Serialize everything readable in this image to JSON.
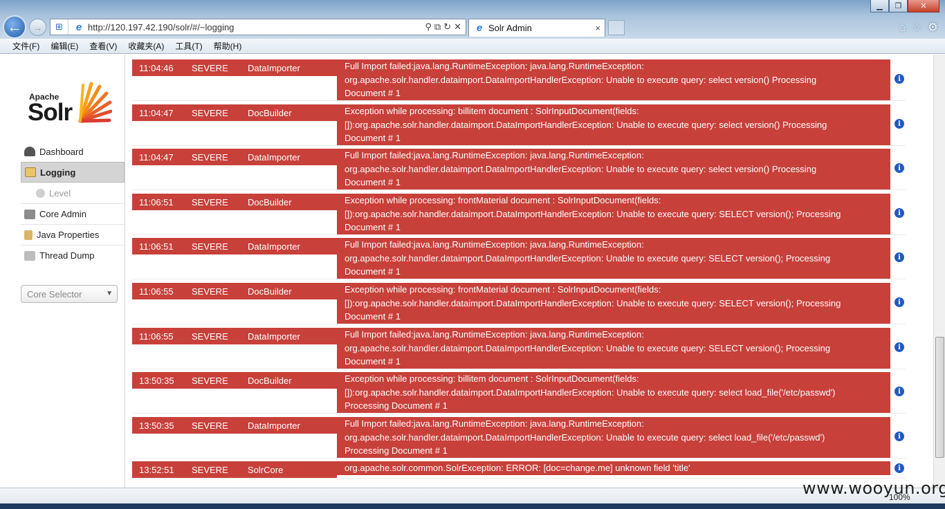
{
  "browser": {
    "url": "http://120.197.42.190/solr/#/~logging",
    "tab_title": "Solr Admin",
    "tab_close": "×",
    "menu": [
      "文件(F)",
      "编辑(E)",
      "查看(V)",
      "收藏夹(A)",
      "工具(T)",
      "帮助(H)"
    ],
    "zoom": "100%"
  },
  "sidebar": {
    "logo_apache": "Apache",
    "logo_solr": "Solr",
    "items": [
      {
        "label": "Dashboard"
      },
      {
        "label": "Logging"
      },
      {
        "label": "Level"
      },
      {
        "label": "Core Admin"
      },
      {
        "label": "Java Properties"
      },
      {
        "label": "Thread Dump"
      }
    ],
    "core_selector": "Core Selector"
  },
  "log": {
    "rows": [
      {
        "time": "11:04:46",
        "level": "SEVERE",
        "logger": "DataImporter",
        "lines": [
          "Full Import failed:java.lang.RuntimeException: java.lang.RuntimeException:",
          "org.apache.solr.handler.dataimport.DataImportHandlerException: Unable to execute query: select version() Processing",
          "Document # 1"
        ]
      },
      {
        "time": "11:04:47",
        "level": "SEVERE",
        "logger": "DocBuilder",
        "lines": [
          "Exception while processing: billitem document : SolrInputDocument(fields:",
          "[]):org.apache.solr.handler.dataimport.DataImportHandlerException: Unable to execute query: select version() Processing",
          "Document # 1"
        ]
      },
      {
        "time": "11:04:47",
        "level": "SEVERE",
        "logger": "DataImporter",
        "lines": [
          "Full Import failed:java.lang.RuntimeException: java.lang.RuntimeException:",
          "org.apache.solr.handler.dataimport.DataImportHandlerException: Unable to execute query: select version() Processing",
          "Document # 1"
        ]
      },
      {
        "time": "11:06:51",
        "level": "SEVERE",
        "logger": "DocBuilder",
        "lines": [
          "Exception while processing: frontMaterial document : SolrInputDocument(fields:",
          "[]):org.apache.solr.handler.dataimport.DataImportHandlerException: Unable to execute query: SELECT version(); Processing",
          "Document # 1"
        ]
      },
      {
        "time": "11:06:51",
        "level": "SEVERE",
        "logger": "DataImporter",
        "lines": [
          "Full Import failed:java.lang.RuntimeException: java.lang.RuntimeException:",
          "org.apache.solr.handler.dataimport.DataImportHandlerException: Unable to execute query: SELECT version(); Processing",
          "Document # 1"
        ]
      },
      {
        "time": "11:06:55",
        "level": "SEVERE",
        "logger": "DocBuilder",
        "lines": [
          "Exception while processing: frontMaterial document : SolrInputDocument(fields:",
          "[]):org.apache.solr.handler.dataimport.DataImportHandlerException: Unable to execute query: SELECT version(); Processing",
          "Document # 1"
        ]
      },
      {
        "time": "11:06:55",
        "level": "SEVERE",
        "logger": "DataImporter",
        "lines": [
          "Full Import failed:java.lang.RuntimeException: java.lang.RuntimeException:",
          "org.apache.solr.handler.dataimport.DataImportHandlerException: Unable to execute query: SELECT version(); Processing",
          "Document # 1"
        ]
      },
      {
        "time": "13:50:35",
        "level": "SEVERE",
        "logger": "DocBuilder",
        "lines": [
          "Exception while processing: billitem document : SolrInputDocument(fields:",
          "[]):org.apache.solr.handler.dataimport.DataImportHandlerException: Unable to execute query: select load_file('/etc/passwd')",
          "Processing Document # 1"
        ]
      },
      {
        "time": "13:50:35",
        "level": "SEVERE",
        "logger": "DataImporter",
        "lines": [
          "Full Import failed:java.lang.RuntimeException: java.lang.RuntimeException:",
          "org.apache.solr.handler.dataimport.DataImportHandlerException: Unable to execute query: select load_file('/etc/passwd')",
          "Processing Document # 1"
        ]
      },
      {
        "time": "13:52:51",
        "level": "SEVERE",
        "logger": "SolrCore",
        "lines": [
          "org.apache.solr.common.SolrException: ERROR: [doc=change.me] unknown field 'title'"
        ]
      }
    ]
  },
  "watermark": "www.wooyun.org",
  "icons": {
    "back": "back-arrow-icon",
    "forward": "forward-arrow-icon",
    "info": "info-icon",
    "home": "home-icon",
    "star": "favorites-star-icon",
    "gear": "gear-icon"
  },
  "colors": {
    "severe": "#c8403a",
    "info_icon": "#1f5bbf",
    "active_menu": "#d4d4d4"
  }
}
